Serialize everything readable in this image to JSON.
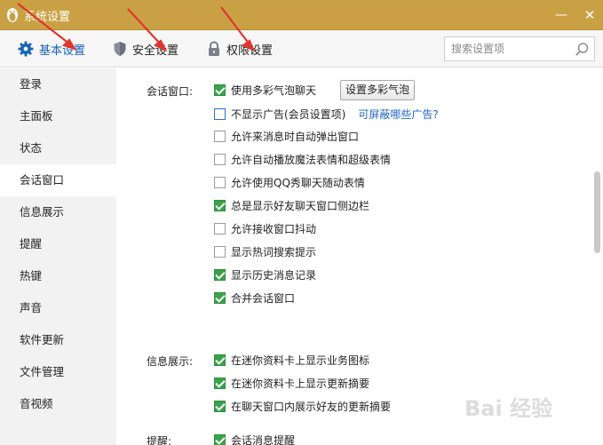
{
  "window": {
    "title": "系统设置",
    "minimize_glyph": "—",
    "close_glyph": "✕"
  },
  "toolbar": {
    "tabs": [
      {
        "label": "基本设置",
        "icon": "gear-icon",
        "active": true
      },
      {
        "label": "安全设置",
        "icon": "shield-icon",
        "active": false
      },
      {
        "label": "权限设置",
        "icon": "lock-icon",
        "active": false
      }
    ],
    "search_placeholder": "搜索设置项"
  },
  "sidebar": {
    "items": [
      "登录",
      "主面板",
      "状态",
      "会话窗口",
      "信息展示",
      "提醒",
      "热键",
      "声音",
      "软件更新",
      "文件管理",
      "音视频"
    ],
    "active_index": 3
  },
  "content": {
    "session_window": {
      "label": "会话窗口:",
      "button": "设置多彩气泡",
      "link": "可屏蔽哪些广告?",
      "options": [
        {
          "label": "使用多彩气泡聊天",
          "checked": true
        },
        {
          "label": "不显示广告(会员设置项)",
          "checked": false
        },
        {
          "label": "允许来消息时自动弹出窗口",
          "checked": false
        },
        {
          "label": "允许自动播放魔法表情和超级表情",
          "checked": false
        },
        {
          "label": "允许使用QQ秀聊天随动表情",
          "checked": false
        },
        {
          "label": "总是显示好友聊天窗口侧边栏",
          "checked": true
        },
        {
          "label": "允许接收窗口抖动",
          "checked": false
        },
        {
          "label": "显示热词搜索提示",
          "checked": false
        },
        {
          "label": "显示历史消息记录",
          "checked": true
        },
        {
          "label": "合并会话窗口",
          "checked": true
        }
      ]
    },
    "info_display": {
      "label": "信息展示:",
      "options": [
        {
          "label": "在迷你资料卡上显示业务图标",
          "checked": true
        },
        {
          "label": "在迷你资料卡上显示更新摘要",
          "checked": true
        },
        {
          "label": "在聊天窗口内展示好友的更新摘要",
          "checked": true
        }
      ]
    },
    "reminder": {
      "label": "提醒:",
      "options": [
        {
          "label": "会话消息提醒",
          "checked": true
        }
      ]
    }
  },
  "colors": {
    "titlebar": "#c9a144",
    "accent": "#1763b8",
    "check_green": "#3aa34a",
    "annotation_arrow": "#e0362c"
  },
  "watermark": "Bai 经验"
}
